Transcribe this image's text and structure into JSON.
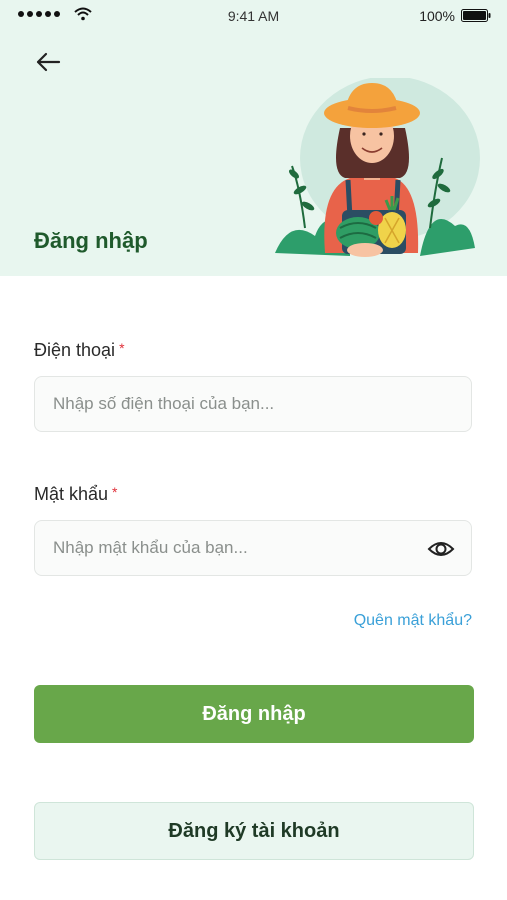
{
  "status_bar": {
    "time": "9:41 AM",
    "battery": "100%"
  },
  "header": {
    "title": "Đăng nhập"
  },
  "form": {
    "phone": {
      "label": "Điện thoại",
      "required_mark": "*",
      "placeholder": "Nhập số điện thoại của bạn..."
    },
    "password": {
      "label": "Mật khẩu",
      "required_mark": "*",
      "placeholder": "Nhập mật khẩu của bạn..."
    },
    "forgot_link": "Quên mật khẩu?"
  },
  "actions": {
    "login_label": "Đăng nhập",
    "register_label": "Đăng ký tài khoản"
  },
  "colors": {
    "primary": "#68a74a",
    "title": "#1f5a2c",
    "link": "#3aa0d8",
    "hero_bg": "#e8f6ef",
    "required": "#e0303a"
  },
  "icons": {
    "back": "arrow-left-icon",
    "eye": "eye-icon",
    "wifi": "wifi-icon",
    "battery": "battery-icon"
  }
}
